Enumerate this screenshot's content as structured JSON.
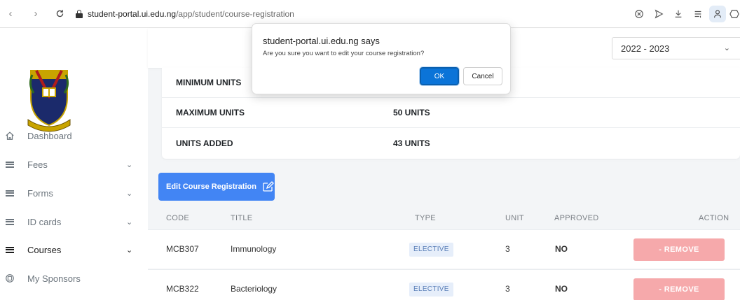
{
  "browser": {
    "url_host": "student-portal.ui.edu.ng",
    "url_path": "/app/student/course-registration"
  },
  "sidebar": {
    "items": [
      {
        "label": "Dashboard",
        "icon": "home-icon",
        "has_chevron": false
      },
      {
        "label": "Fees",
        "icon": "list-icon",
        "has_chevron": true
      },
      {
        "label": "Forms",
        "icon": "list-icon",
        "has_chevron": true
      },
      {
        "label": "ID cards",
        "icon": "list-icon",
        "has_chevron": true
      },
      {
        "label": "Courses",
        "icon": "list-icon",
        "has_chevron": true,
        "active": true
      },
      {
        "label": "My Sponsors",
        "icon": "sponsor-icon",
        "has_chevron": false
      }
    ]
  },
  "session": {
    "selected": "2022 - 2023"
  },
  "units": [
    {
      "label": "MINIMUM UNITS",
      "value": ""
    },
    {
      "label": "MAXIMUM UNITS",
      "value": "50 UNITS"
    },
    {
      "label": "UNITS ADDED",
      "value": "43 UNITS"
    }
  ],
  "edit_button": {
    "label": "Edit Course Registration"
  },
  "table": {
    "headers": {
      "code": "CODE",
      "title": "TITLE",
      "type": "TYPE",
      "unit": "UNIT",
      "approved": "APPROVED",
      "action": "ACTION"
    },
    "rows": [
      {
        "code": "MCB307",
        "title": "Immunology",
        "type": "ELECTIVE",
        "unit": "3",
        "approved": "NO",
        "action": "- REMOVE"
      },
      {
        "code": "MCB322",
        "title": "Bacteriology",
        "type": "ELECTIVE",
        "unit": "3",
        "approved": "NO",
        "action": "- REMOVE"
      }
    ]
  },
  "dialog": {
    "title": "student-portal.ui.edu.ng says",
    "message": "Are you sure you want to edit your course registration?",
    "ok": "OK",
    "cancel": "Cancel"
  },
  "colors": {
    "primary": "#4285f4",
    "remove": "#f6a9ab",
    "badge_bg": "#e6eefa",
    "ok_button": "#0b74d8"
  }
}
